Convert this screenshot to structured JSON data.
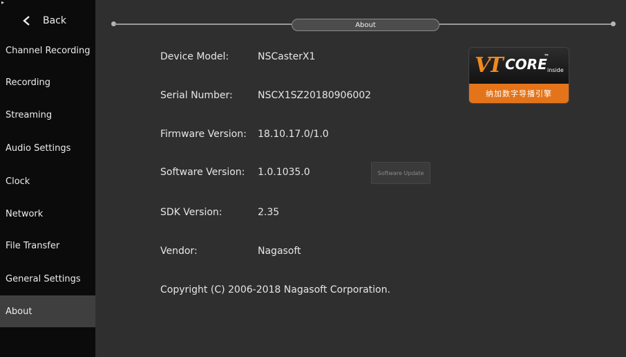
{
  "sidebar": {
    "back_label": "Back",
    "items": [
      {
        "label": "Channel Recording"
      },
      {
        "label": "Recording"
      },
      {
        "label": "Streaming"
      },
      {
        "label": "Audio Settings"
      },
      {
        "label": "Clock"
      },
      {
        "label": "Network"
      },
      {
        "label": "File Transfer"
      },
      {
        "label": "General Settings"
      },
      {
        "label": "About",
        "active": true
      }
    ]
  },
  "header": {
    "title": "About"
  },
  "info": {
    "device_model": {
      "label": "Device Model:",
      "value": "NSCasterX1"
    },
    "serial_number": {
      "label": "Serial Number:",
      "value": "NSCX1SZ20180906002"
    },
    "firmware_version": {
      "label": "Firmware Version:",
      "value": "18.10.17.0/1.0"
    },
    "software_version": {
      "label": "Software Version:",
      "value": "1.0.1035.0"
    },
    "sdk_version": {
      "label": "SDK Version:",
      "value": "2.35"
    },
    "vendor": {
      "label": "Vendor:",
      "value": "Nagasoft"
    }
  },
  "software_update_label": "Software Update",
  "copyright": "Copyright (C) 2006-2018 Nagasoft Corporation.",
  "logo": {
    "brand": "VT",
    "core": "CORE",
    "tm": "™",
    "inside": "inside",
    "tagline": "纳加数字导播引擎"
  },
  "colors": {
    "sidebar_bg": "#0b0b0b",
    "main_bg": "#2f2f2f",
    "active_item_bg": "#3f3f3f",
    "logo_orange": "#e4741a"
  }
}
